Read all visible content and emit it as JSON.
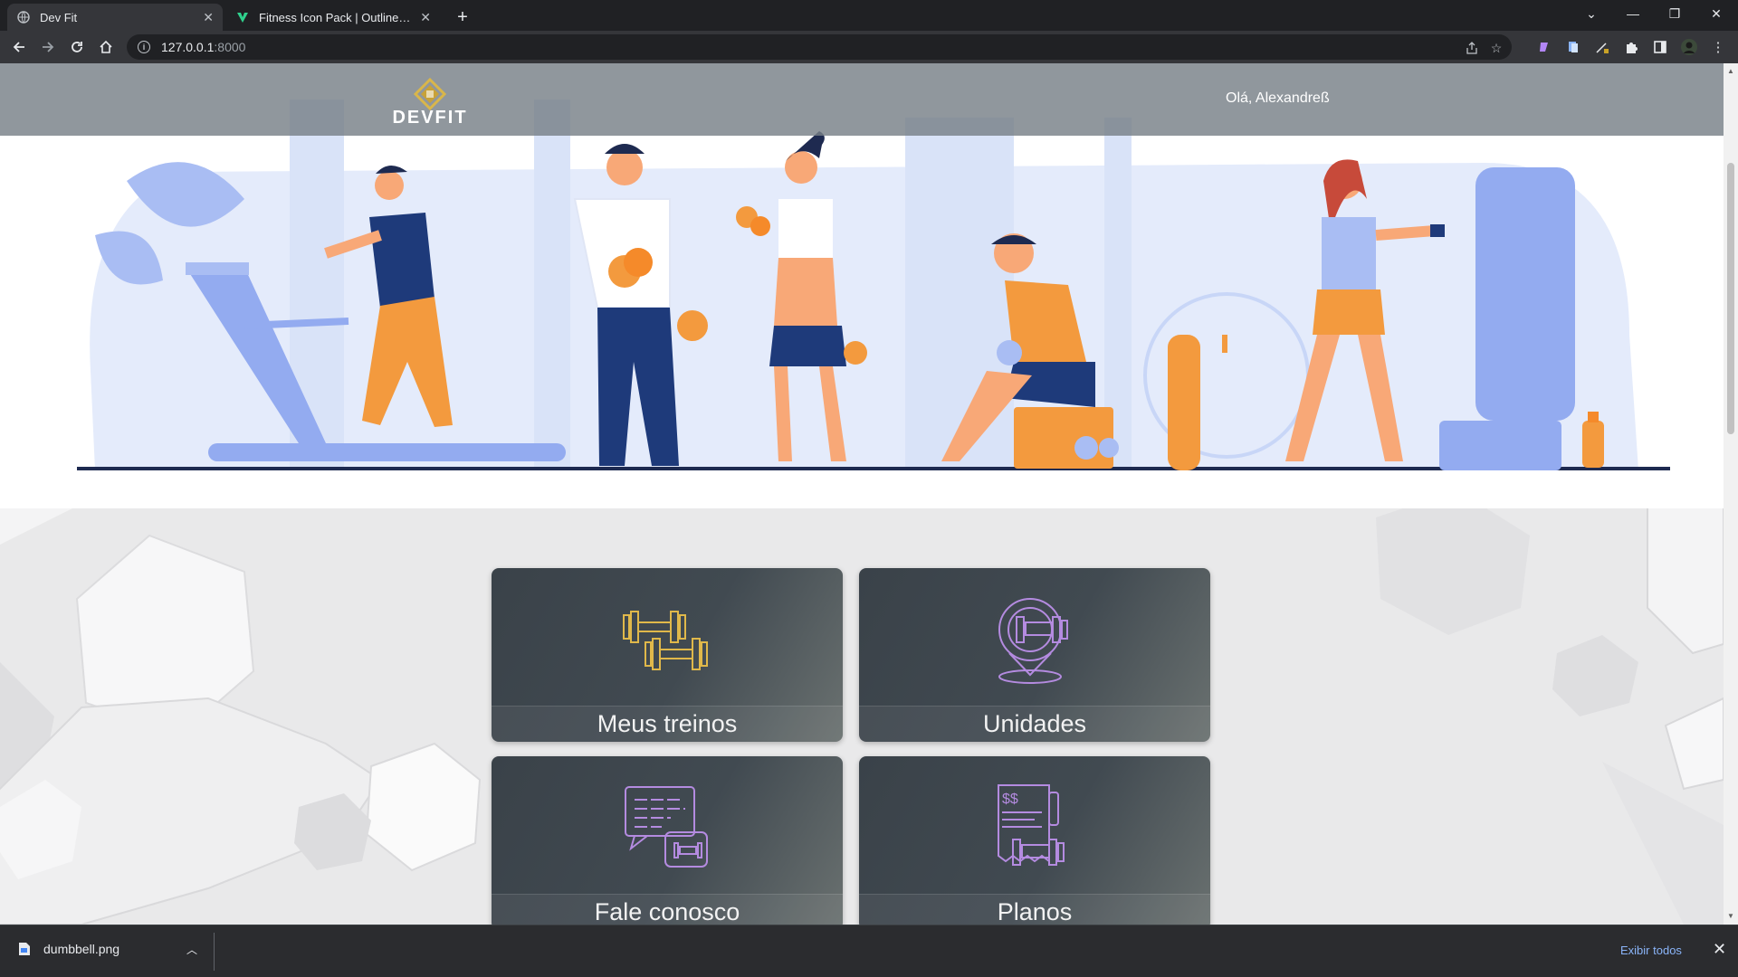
{
  "browser": {
    "tabs": [
      {
        "title": "Dev Fit",
        "active": true
      },
      {
        "title": "Fitness Icon Pack | Outline Gradient",
        "active": false
      }
    ],
    "url_host": "127.0.0.1",
    "url_port": ":8000",
    "window_controls": {
      "dropdown": "⌄",
      "minimize": "—",
      "restore": "❐",
      "close": "✕"
    }
  },
  "site": {
    "logo_text": "DEVFIT",
    "greeting": "Olá, Alexandreß",
    "cards": [
      {
        "label": "Meus treinos",
        "icon": "dumbbell-icon"
      },
      {
        "label": "Unidades",
        "icon": "location-dumbbell-icon"
      },
      {
        "label": "Fale conosco",
        "icon": "chat-dumbbell-icon"
      },
      {
        "label": "Planos",
        "icon": "invoice-dumbbell-icon"
      }
    ]
  },
  "downloads": {
    "file_name": "dumbbell.png",
    "show_all": "Exibir todos"
  },
  "colors": {
    "accent_blue": "#8ab4f8",
    "card_icon_gold": "#e0b84a",
    "card_icon_purple": "#b48be0",
    "hero_blue": "#a9bdf3",
    "hero_orange": "#f39a3e",
    "hero_navy": "#1e3a7a"
  }
}
